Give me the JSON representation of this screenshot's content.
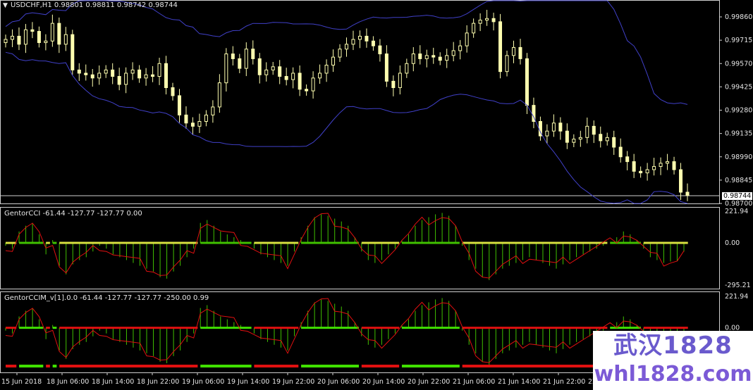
{
  "symbol_header": "USDCHF,H1  0.98801 0.98811 0.98742 0.98744",
  "current_price": "0.98744",
  "price_axis": [
    "0.99860",
    "0.99715",
    "0.99570",
    "0.99425",
    "0.99280",
    "0.99135",
    "0.98990",
    "0.98845",
    "0.98700"
  ],
  "cci_header": "GentorCCI -61.44 -127.77 -127.77 0.00",
  "cci_axis": [
    "221.94",
    "0.00",
    "-295.21"
  ],
  "ccim_header": "GentorCCIM_v[1].0.0 -61.44 -127.77 -127.77 -250.00 0.99",
  "ccim_axis": [
    "221.94",
    "0.00"
  ],
  "time_axis": [
    "15 Jun 2018",
    "18 Jun 06:00",
    "18 Jun 14:00",
    "18 Jun 22:00",
    "19 Jun 06:00",
    "19 Jun 14:00",
    "19 Jun 22:00",
    "20 Jun 06:00",
    "20 Jun 14:00",
    "20 Jun 22:00",
    "21 Jun 06:00",
    "21 Jun 14:00",
    "21 Jun 22:00",
    "22"
  ],
  "watermark_line1": "武汉1828",
  "watermark_line2": "whl1828.com",
  "colors": {
    "background": "#000000",
    "candle": "#ffffb0",
    "bollinger": "#4040c8",
    "cci_line": "#e01010",
    "hist_up": "#40c000",
    "hist_down": "#d8e040",
    "ccim_up": "#40e000",
    "ccim_down": "#e01010",
    "watermark": "#6a5acd"
  },
  "chart_data": {
    "type": "candlestick",
    "symbol": "USDCHF",
    "timeframe": "H1",
    "ohlc_last": {
      "open": 0.98801,
      "high": 0.98811,
      "low": 0.98742,
      "close": 0.98744
    },
    "close": [
      0.9972,
      0.9974,
      0.9969,
      0.9978,
      0.9977,
      0.997,
      0.9971,
      0.9982,
      0.9969,
      0.9975,
      0.9953,
      0.9951,
      0.995,
      0.9948,
      0.9951,
      0.9953,
      0.9949,
      0.9944,
      0.9951,
      0.9953,
      0.9948,
      0.995,
      0.9949,
      0.9957,
      0.9942,
      0.9937,
      0.9925,
      0.992,
      0.9918,
      0.9921,
      0.9925,
      0.993,
      0.9945,
      0.9963,
      0.996,
      0.9954,
      0.9966,
      0.996,
      0.995,
      0.9953,
      0.9955,
      0.9949,
      0.9947,
      0.9951,
      0.9941,
      0.994,
      0.9948,
      0.9951,
      0.9956,
      0.9961,
      0.9966,
      0.9969,
      0.9972,
      0.9974,
      0.9971,
      0.9968,
      0.9963,
      0.9946,
      0.9942,
      0.9951,
      0.9957,
      0.9963,
      0.996,
      0.9962,
      0.9961,
      0.9959,
      0.9962,
      0.9965,
      0.9968,
      0.9976,
      0.9982,
      0.9984,
      0.9985,
      0.9983,
      0.9952,
      0.9962,
      0.9967,
      0.996,
      0.9931,
      0.9921,
      0.9912,
      0.9915,
      0.992,
      0.9915,
      0.9908,
      0.991,
      0.9911,
      0.9918,
      0.9913,
      0.9909,
      0.9911,
      0.9905,
      0.9899,
      0.9896,
      0.989,
      0.9889,
      0.9891,
      0.9893,
      0.9895,
      0.9896,
      0.9891,
      0.9877,
      0.9875
    ],
    "cci": [
      -20,
      -40,
      80,
      120,
      140,
      60,
      -80,
      20,
      -160,
      -220,
      -150,
      -120,
      -100,
      -60,
      -20,
      -40,
      -80,
      -100,
      -120,
      -140,
      -160,
      -180,
      -200,
      -240,
      -250,
      -200,
      -160,
      -100,
      -40,
      140,
      160,
      120,
      80,
      60,
      40,
      20,
      0,
      -40,
      -80,
      -100,
      -120,
      -140,
      -160,
      -60,
      40,
      120,
      180,
      200,
      190,
      170,
      150,
      120,
      40,
      -60,
      -120,
      -140,
      -120,
      -80,
      -40,
      20,
      60,
      120,
      160,
      180,
      200,
      210,
      190,
      120,
      -20,
      -120,
      -180,
      -240,
      -260,
      -220,
      -180,
      -160,
      -140,
      -120,
      -100,
      -120,
      -140,
      -160,
      -180,
      -150,
      -120,
      -100,
      -80,
      -60,
      -40,
      -20,
      0,
      40,
      80,
      60,
      20,
      -40,
      -100,
      -120,
      -140,
      -130,
      -127.77,
      -61.44
    ],
    "cci_last": {
      "value1": -61.44,
      "value2": -127.77,
      "value3": -127.77,
      "value4": 0.0
    },
    "ccim_last": {
      "value1": -61.44,
      "value2": -127.77,
      "value3": -127.77,
      "value4": -250.0,
      "value5": 0.99
    }
  }
}
